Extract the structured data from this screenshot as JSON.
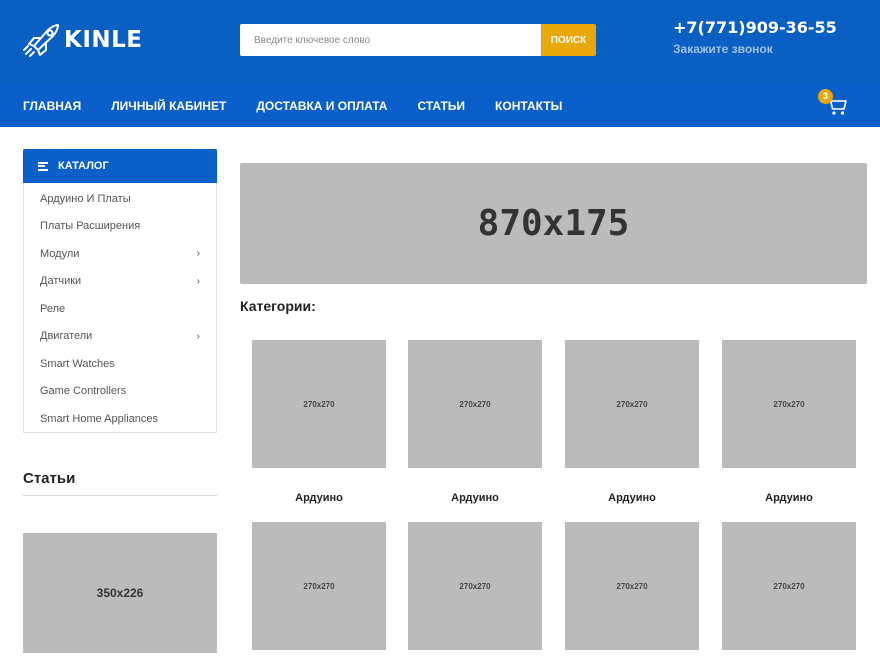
{
  "header": {
    "logo_text": "KINLE",
    "search_placeholder": "Введите ключевое слово",
    "search_button": "ПОИСК",
    "phone": "+7(771)909-36-55",
    "callback": "Закажите звонок"
  },
  "nav": {
    "items": [
      "ГЛАВНАЯ",
      "ЛИЧНЫЙ КАБИНЕТ",
      "ДОСТАВКА И ОПЛАТА",
      "СТАТЬИ",
      "КОНТАКТЫ"
    ],
    "cart_count": "3"
  },
  "catalog": {
    "title": "КАТАЛОГ",
    "items": [
      {
        "label": "Ардуино И Платы",
        "chevron": ""
      },
      {
        "label": "Платы Расширения",
        "chevron": ""
      },
      {
        "label": "Модули",
        "chevron": "›"
      },
      {
        "label": "Датчики",
        "chevron": "›"
      },
      {
        "label": "Реле",
        "chevron": ""
      },
      {
        "label": "Двигатели",
        "chevron": "›"
      },
      {
        "label": "Smart Watches",
        "chevron": ""
      },
      {
        "label": "Game Controllers",
        "chevron": ""
      },
      {
        "label": "Smart Home Appliances",
        "chevron": ""
      }
    ]
  },
  "articles": {
    "title": "Статьи",
    "image_placeholder": "350x226"
  },
  "main": {
    "banner_placeholder": "870x175",
    "categories_title": "Категории:",
    "categories": [
      {
        "image": "270x270",
        "label": "Ардуино"
      },
      {
        "image": "270x270",
        "label": "Ардуино"
      },
      {
        "image": "270x270",
        "label": "Ардуино"
      },
      {
        "image": "270x270",
        "label": "Ардуино"
      },
      {
        "image": "270x270",
        "label": ""
      },
      {
        "image": "270x270",
        "label": ""
      },
      {
        "image": "270x270",
        "label": ""
      },
      {
        "image": "270x270",
        "label": ""
      }
    ]
  },
  "colors": {
    "brand_blue": "#0a5fc2",
    "accent_yellow": "#e8a80a",
    "placeholder_gray": "#bbbbbb"
  }
}
